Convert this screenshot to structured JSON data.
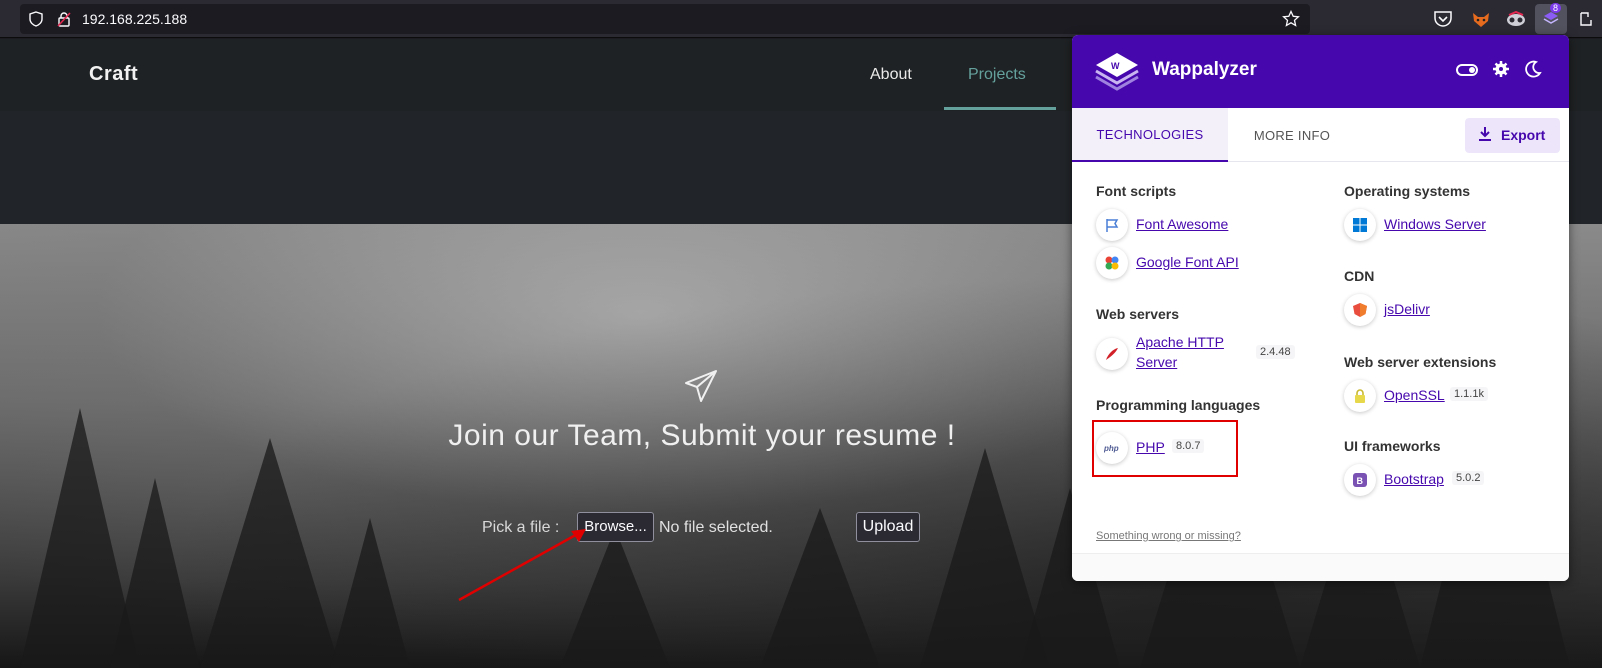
{
  "browser": {
    "url": "192.168.225.188",
    "extension_badge": "8"
  },
  "site": {
    "brand": "Craft",
    "nav": {
      "about": "About",
      "projects": "Projects"
    },
    "hero_title": "Join our Team, Submit your resume !",
    "pick_label": "Pick a file :",
    "browse_label": "Browse...",
    "no_file": "No file selected.",
    "upload_label": "Upload"
  },
  "wappalyzer": {
    "title": "Wappalyzer",
    "tabs": {
      "technologies": "TECHNOLOGIES",
      "more_info": "MORE INFO"
    },
    "export_label": "Export",
    "left_categories": [
      {
        "title": "Font scripts",
        "items": [
          {
            "name": "Font Awesome",
            "version": "",
            "icon": "flag-icon"
          },
          {
            "name": "Google Font API",
            "version": "",
            "icon": "google-fonts-icon"
          }
        ]
      },
      {
        "title": "Web servers",
        "items": [
          {
            "name": "Apache HTTP Server",
            "version": "2.4.48",
            "icon": "apache-feather-icon"
          }
        ]
      },
      {
        "title": "Programming languages",
        "items": [
          {
            "name": "PHP",
            "version": "8.0.7",
            "icon": "php-icon"
          }
        ]
      }
    ],
    "right_categories": [
      {
        "title": "Operating systems",
        "items": [
          {
            "name": "Windows Server",
            "version": "",
            "icon": "windows-icon"
          }
        ]
      },
      {
        "title": "CDN",
        "items": [
          {
            "name": "jsDelivr",
            "version": "",
            "icon": "jsdelivr-icon"
          }
        ]
      },
      {
        "title": "Web server extensions",
        "items": [
          {
            "name": "OpenSSL",
            "version": "1.1.1k",
            "icon": "lock-icon"
          }
        ]
      },
      {
        "title": "UI frameworks",
        "items": [
          {
            "name": "Bootstrap",
            "version": "5.0.2",
            "icon": "bootstrap-icon"
          }
        ]
      }
    ],
    "apache_line1": "Apache HTTP",
    "apache_line2": "Server",
    "footer_link": "Something wrong or missing?"
  },
  "colors": {
    "wappalyzer_purple": "#4608ad",
    "highlight_red": "#e00000",
    "nav_accent": "#64a19d"
  }
}
